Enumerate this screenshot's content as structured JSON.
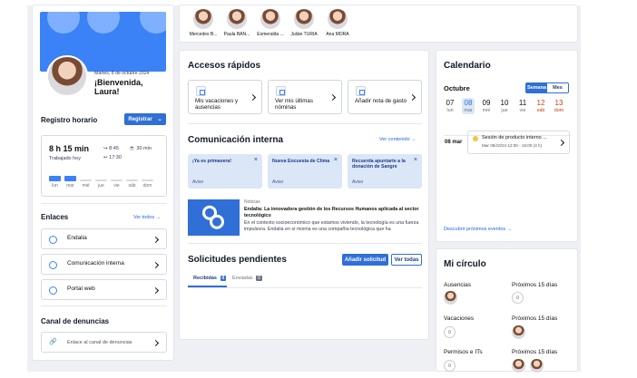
{
  "people": [
    {
      "name": "Mercedes B..."
    },
    {
      "name": "Paula BAN..."
    },
    {
      "name": "Esmeralda ..."
    },
    {
      "name": "Julián TURIA"
    },
    {
      "name": "Ana MORA"
    }
  ],
  "profile": {
    "date": "Martes, 8 de octubre 2024",
    "greeting": "¡Bienvenida, Laura!"
  },
  "registro": {
    "title": "Registro horario",
    "button": "Registrar",
    "worked": "8 h 15 min",
    "worked_label": "Trabajado hoy",
    "in_time": "8:45",
    "out_time": "17:30",
    "break": "30 min",
    "days": [
      {
        "label": "lun",
        "filled": true
      },
      {
        "label": "mar",
        "filled": true
      },
      {
        "label": "mié",
        "filled": false
      },
      {
        "label": "jue",
        "filled": false
      },
      {
        "label": "vie",
        "filled": false
      },
      {
        "label": "sáb",
        "filled": false
      },
      {
        "label": "dom",
        "filled": false
      }
    ]
  },
  "enlaces": {
    "title": "Enlaces",
    "see_all": "Ver todos",
    "items": [
      "Endalia",
      "Comunicación interna",
      "Portal web"
    ]
  },
  "denuncias": {
    "title": "Canal de denuncias",
    "link": "Enlace al canal de denuncias"
  },
  "accesos": {
    "title": "Accesos rápidos",
    "items": [
      "Mis vacaciones y ausencias",
      "Ver mis últimas nóminas",
      "Añadir nota de gasto"
    ]
  },
  "comunicacion": {
    "title": "Comunicación interna",
    "see_content": "Ver contenido",
    "notices": [
      {
        "text": "¡Ya es primavera!",
        "tag": "Aviso"
      },
      {
        "text": "Nueva Encuesta de Clima",
        "tag": "Aviso"
      },
      {
        "text": "Recuerda apuntarte a la donación de Sangre",
        "tag": "Aviso"
      }
    ],
    "news_label": "Noticias",
    "news_title": "Endalia: La innovadora gestión de los Recursos Humanos aplicada al sector tecnológico",
    "news_body": "En el contexto socioeconómico que estamos viviendo, la tecnología es una fuerza impulsora. Endalia en sí misma es una compañía tecnológica que ha"
  },
  "solicitudes": {
    "title": "Solicitudes pendientes",
    "add": "Añadir solicitud",
    "see_all": "Ver todas",
    "tab_received": "Recibidas",
    "tab_received_count": "0",
    "tab_sent": "Enviadas",
    "tab_sent_count": "0"
  },
  "calendario": {
    "title": "Calendario",
    "month": "Octubre",
    "view_week": "Semana",
    "view_month": "Mes",
    "days": [
      {
        "num": "07",
        "wd": "lun"
      },
      {
        "num": "08",
        "wd": "mar"
      },
      {
        "num": "09",
        "wd": "mié"
      },
      {
        "num": "10",
        "wd": "jue"
      },
      {
        "num": "11",
        "wd": "vie"
      },
      {
        "num": "12",
        "wd": "sáb"
      },
      {
        "num": "13",
        "wd": "dom"
      }
    ],
    "event_day": "08 mar",
    "event_title": "Sesión de producto interno ...",
    "event_time": "Mar 08/10/24 12:00 - 16:00 (4 h)",
    "discover": "Descubrir próximos eventos"
  },
  "circulo": {
    "title": "Mi círculo",
    "ausencias": "Ausencias",
    "prox1": "Próximos 15 días",
    "prox1_count": "0",
    "vacaciones": "Vacaciones",
    "vac_count": "0",
    "prox2": "Próximos 15 días",
    "permisos": "Permisos e ITs",
    "perm_count": "0",
    "prox3": "Próximos 15 días"
  },
  "colors": {
    "accent": "#2f6fd6",
    "banner": "#3b82f6",
    "weekend": "#c2410c"
  }
}
